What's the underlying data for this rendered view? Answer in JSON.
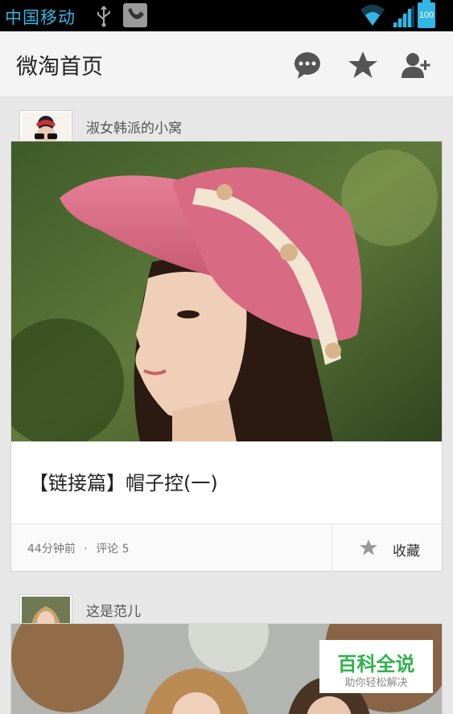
{
  "status_bar": {
    "carrier": "中国移动",
    "battery": "100",
    "icons": [
      "usb-icon",
      "app-notification-icon",
      "wifi-icon",
      "signal-icon",
      "battery-icon"
    ]
  },
  "action_bar": {
    "title": "微淘首页",
    "icons": [
      "message-icon",
      "star-icon",
      "add-user-icon"
    ]
  },
  "posts": [
    {
      "author": "淑女韩派的小窝",
      "title": "【链接篇】帽子控(一)",
      "time": "44分钟前",
      "separator": "·",
      "comments": "评论 5",
      "favorite_label": "收藏"
    },
    {
      "author": "这是范儿"
    }
  ],
  "watermark": {
    "main": "百科全说",
    "sub": "助你轻松解决"
  },
  "colors": {
    "status_accent": "#33b5e5",
    "watermark_green": "#2fb34a"
  }
}
